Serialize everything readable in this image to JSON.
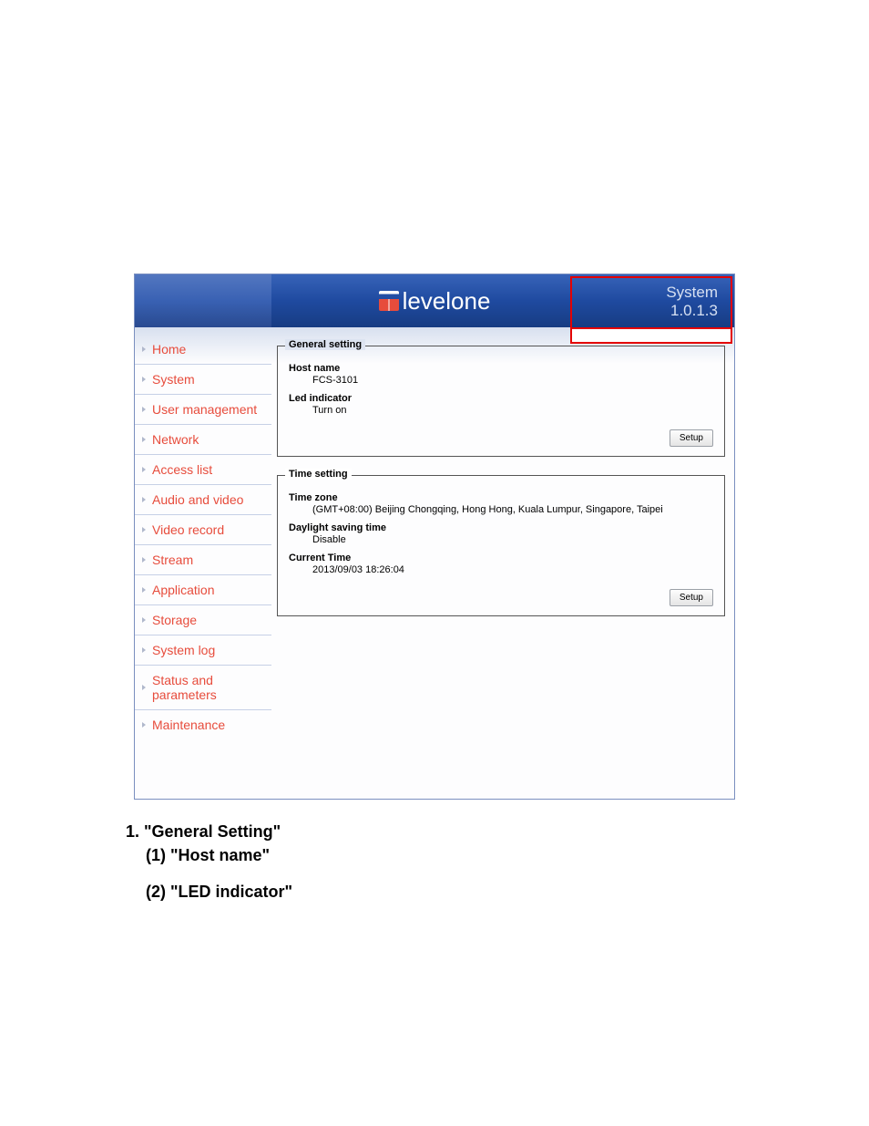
{
  "header": {
    "logo_text": "levelone",
    "right_line1": "System",
    "right_line2": "1.0.1.3"
  },
  "nav": {
    "items": [
      {
        "label": "Home"
      },
      {
        "label": "System"
      },
      {
        "label": "User management"
      },
      {
        "label": "Network"
      },
      {
        "label": "Access list"
      },
      {
        "label": "Audio and video"
      },
      {
        "label": "Video record"
      },
      {
        "label": "Stream"
      },
      {
        "label": "Application"
      },
      {
        "label": "Storage"
      },
      {
        "label": "System log"
      },
      {
        "label": "Status and parameters"
      },
      {
        "label": "Maintenance"
      }
    ]
  },
  "panels": {
    "general": {
      "legend": "General setting",
      "host_name_label": "Host name",
      "host_name_value": "FCS-3101",
      "led_label": "Led indicator",
      "led_value": "Turn on",
      "setup_btn": "Setup"
    },
    "time": {
      "legend": "Time setting",
      "tz_label": "Time zone",
      "tz_value": "(GMT+08:00) Beijing Chongqing, Hong Hong, Kuala Lumpur, Singapore, Taipei",
      "dst_label": "Daylight saving time",
      "dst_value": "Disable",
      "cur_label": "Current Time",
      "cur_value": "2013/09/03 18:26:04",
      "setup_btn": "Setup"
    }
  },
  "doc": {
    "sect1": "1. \"General Setting\"",
    "sub1": "(1) \"Host name\"",
    "sub2": "(2) \"LED indicator\""
  }
}
